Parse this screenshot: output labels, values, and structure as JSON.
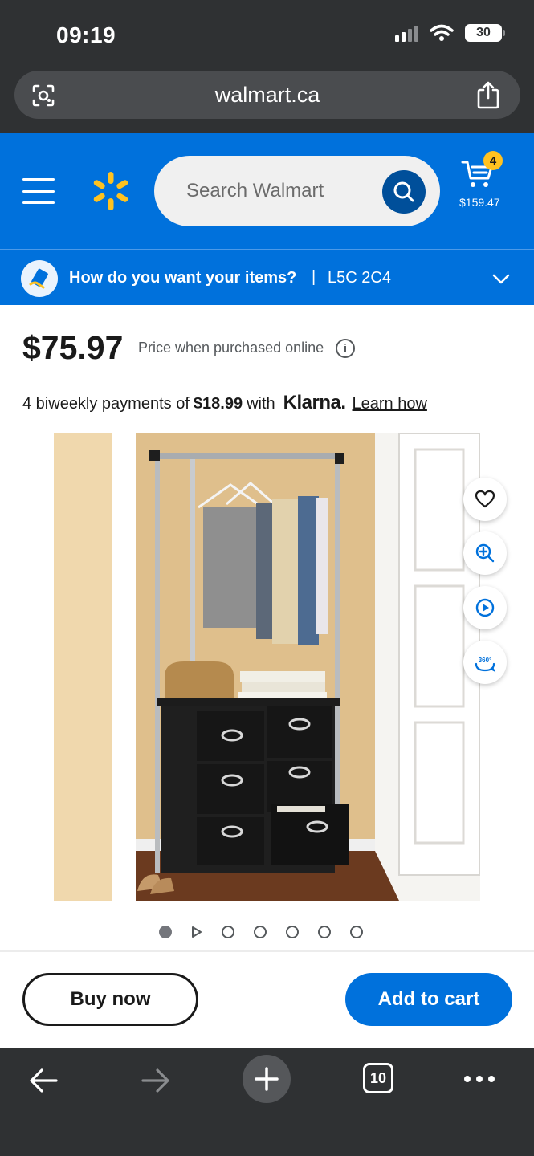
{
  "status_bar": {
    "time": "09:19",
    "battery": "30"
  },
  "browser": {
    "url": "walmart.ca",
    "tab_count": "10"
  },
  "header": {
    "search_placeholder": "Search Walmart",
    "cart_count": "4",
    "cart_total": "$159.47",
    "colors": {
      "brand_blue": "#0071dc",
      "spark_yellow": "#ffc220"
    }
  },
  "delivery": {
    "prompt": "How do you want your items?",
    "separator": "|",
    "postal_code": "L5C 2C4"
  },
  "product": {
    "price": "$75.97",
    "price_note": "Price when purchased online",
    "klarna": {
      "prefix": "4 biweekly payments of",
      "amount": "$18.99",
      "with": "with",
      "brand": "Klarna.",
      "link": "Learn how"
    },
    "image_alt": "Closet organizer with hanging rod and fabric drawers",
    "image_actions": [
      "heart-icon",
      "zoom-in-icon",
      "play-video-icon",
      "360-view-icon"
    ],
    "image_360_label": "360°",
    "carousel": {
      "total": 7,
      "active_index": 0
    }
  },
  "actions": {
    "buy_now": "Buy now",
    "add_to_cart": "Add to cart"
  }
}
